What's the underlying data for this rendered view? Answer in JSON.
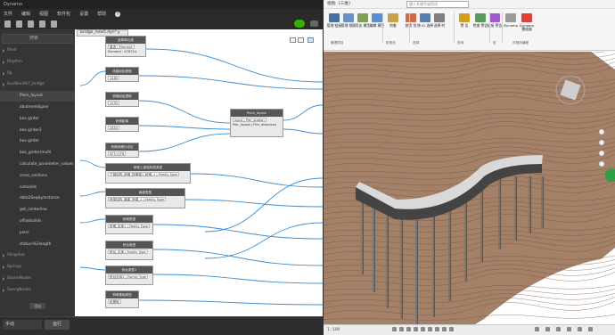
{
  "dynamo": {
    "window_title": "Dynamo",
    "menu": [
      "文件",
      "编辑",
      "视图",
      "软件包",
      "设置",
      "帮助"
    ],
    "help_glyph": "?",
    "tab_label": "bridge_new5.dyn*",
    "tab_close": "×",
    "search_placeholder": "搜索",
    "library": [
      {
        "label": "Revit",
        "type": "cat"
      },
      {
        "label": "Rhythm",
        "type": "cat"
      },
      {
        "label": "SJL",
        "type": "cat"
      },
      {
        "label": "SunWorld07_bridge",
        "type": "cat",
        "expanded": true
      },
      {
        "label": "Piers_layout",
        "type": "sub",
        "selected": true
      },
      {
        "label": "abutment&pier",
        "type": "sub"
      },
      {
        "label": "box girder",
        "type": "sub"
      },
      {
        "label": "box girder2",
        "type": "sub"
      },
      {
        "label": "box girder",
        "type": "sub"
      },
      {
        "label": "box_girder(multi",
        "type": "sub"
      },
      {
        "label": "calculate_parameter_values",
        "type": "sub"
      },
      {
        "label": "cross_sections",
        "type": "sub"
      },
      {
        "label": "cutsolids",
        "type": "sub"
      },
      {
        "label": "data2Seq&yInstance",
        "type": "sub"
      },
      {
        "label": "get_centerline",
        "type": "sub"
      },
      {
        "label": "offsetsolids",
        "type": "sub"
      },
      {
        "label": "piers",
        "type": "sub"
      },
      {
        "label": "station%2length",
        "type": "sub"
      },
      {
        "label": "Slingshot",
        "type": "cat"
      },
      {
        "label": "Springs",
        "type": "cat"
      },
      {
        "label": "SteamNodes",
        "type": "cat"
      },
      {
        "label": "SwergNodes",
        "type": "cat"
      }
    ],
    "library_button": "添加",
    "run_mode": "手动",
    "run_button": "运行",
    "nodes": [
      {
        "id": "n1",
        "title": "选择单元类",
        "body": "重选 | Element",
        "extra": "Element : 476714"
      },
      {
        "id": "n2",
        "title": "线路起始里程",
        "body": "1480"
      },
      {
        "id": "n3",
        "title": "桥墩起始里程",
        "body": "1550"
      },
      {
        "id": "n4",
        "title": "桥墩距离",
        "body": "2850"
      },
      {
        "id": "n5",
        "title": "桥墩间隔分设定",
        "body": "5F3+1F6"
      },
      {
        "id": "n6",
        "title": "Piers_layout",
        "body": "input | Pier_station",
        "extra": "Pier_layout | Pier_distances"
      },
      {
        "id": "n7",
        "title": "桥墩上部结构族类型",
        "body": "下部结构_桥墩_桥墩族1_桥墩_1 | Family Type"
      },
      {
        "id": "n8",
        "title": "扁梁类型",
        "body": "桥梁结构_箱梁_桥梁_1 | Family Type"
      },
      {
        "id": "n9",
        "title": "桥墩类型",
        "body": "桥墩_实体1 | Family Type"
      },
      {
        "id": "n10",
        "title": "桥台类型",
        "body": "桥台_实体 | Family Type"
      },
      {
        "id": "n11",
        "title": "桥台类型2",
        "body": "桥台实体2 | Family Type"
      },
      {
        "id": "n12",
        "title": "桥墩基础类型",
        "body": "桩基础"
      }
    ]
  },
  "revit": {
    "title": "视图: {三维}",
    "search_placeholder": "键入关键字或短语",
    "ribbon": [
      {
        "label": "管理 链接"
      },
      {
        "label": "管理 视图"
      },
      {
        "label": "导出 模型"
      },
      {
        "label": "编辑 模型"
      },
      {
        "label": "附着"
      },
      {
        "label": "按类 别"
      },
      {
        "label": "按 ID 选择"
      },
      {
        "label": "选择 时"
      },
      {
        "label": "警 告"
      },
      {
        "label": "检查 警告"
      },
      {
        "label": "链接 警告"
      },
      {
        "label": "Dynamo"
      },
      {
        "label": "Dynamo 播放器"
      }
    ],
    "groups": [
      "管理项目",
      "阶段化",
      "选择",
      "查询",
      "宏",
      "可视化编程"
    ],
    "status_scale": "1 : 100",
    "colors": {
      "terrain": "#a58068",
      "terrain_dark": "#6b4a3a",
      "deck": "#d9d9d9",
      "accent": "#2ea043"
    }
  }
}
